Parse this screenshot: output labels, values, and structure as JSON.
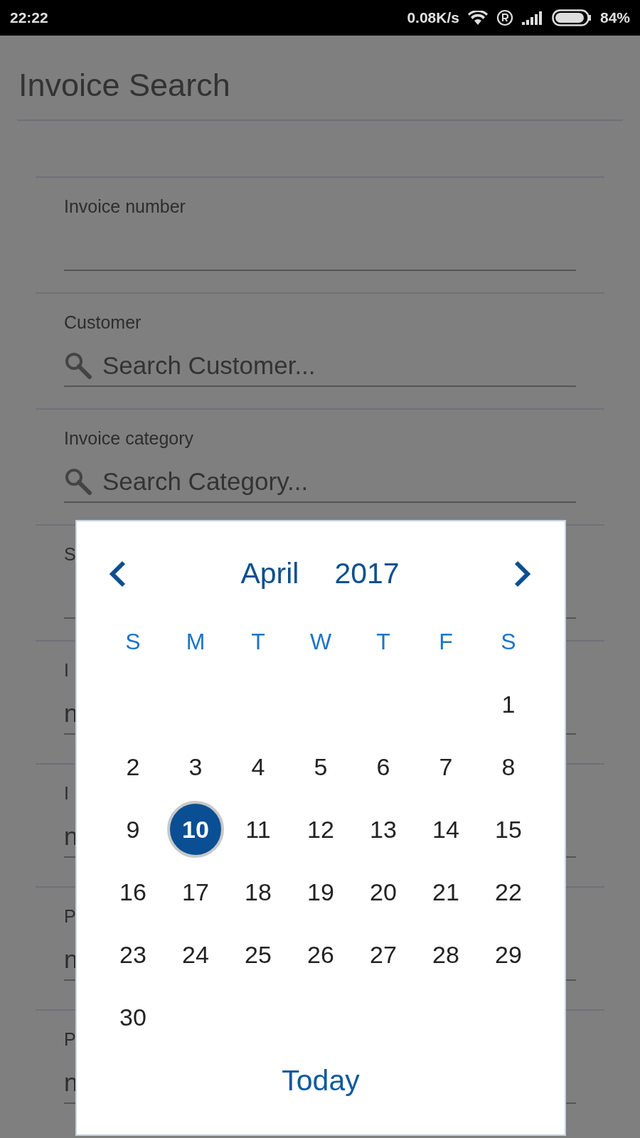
{
  "status_bar": {
    "time": "22:22",
    "net_speed": "0.08K/s",
    "battery": "84%"
  },
  "page": {
    "title": "Invoice Search"
  },
  "fields": [
    {
      "kind": "text",
      "label": "Invoice number"
    },
    {
      "kind": "search",
      "label": "Customer",
      "placeholder": "Search Customer..."
    },
    {
      "kind": "search",
      "label": "Invoice category",
      "placeholder": "Search Category..."
    },
    {
      "kind": "text",
      "label": "S"
    },
    {
      "kind": "text",
      "label": "I",
      "value": "n"
    },
    {
      "kind": "text",
      "label": "I",
      "value": "n"
    },
    {
      "kind": "text",
      "label": "P",
      "value": "n"
    },
    {
      "kind": "text",
      "label": "P",
      "value": "n"
    }
  ],
  "date_picker": {
    "month": "April",
    "year": "2017",
    "weekdays": [
      "S",
      "M",
      "T",
      "W",
      "T",
      "F",
      "S"
    ],
    "weeks": [
      {
        "kind": "first_week",
        "days": [
          {
            "day": "1",
            "selected": false
          }
        ]
      },
      {
        "kind": "week",
        "days": [
          {
            "day": "2",
            "selected": false
          },
          {
            "day": "3",
            "selected": false
          },
          {
            "day": "4",
            "selected": false
          },
          {
            "day": "5",
            "selected": false
          },
          {
            "day": "6",
            "selected": false
          },
          {
            "day": "7",
            "selected": false
          },
          {
            "day": "8",
            "selected": false
          }
        ]
      },
      {
        "kind": "week",
        "days": [
          {
            "day": "9",
            "selected": false
          },
          {
            "day": "10",
            "selected": true
          },
          {
            "day": "11",
            "selected": false
          },
          {
            "day": "12",
            "selected": false
          },
          {
            "day": "13",
            "selected": false
          },
          {
            "day": "14",
            "selected": false
          },
          {
            "day": "15",
            "selected": false
          }
        ]
      },
      {
        "kind": "week",
        "days": [
          {
            "day": "16",
            "selected": false
          },
          {
            "day": "17",
            "selected": false
          },
          {
            "day": "18",
            "selected": false
          },
          {
            "day": "19",
            "selected": false
          },
          {
            "day": "20",
            "selected": false
          },
          {
            "day": "21",
            "selected": false
          },
          {
            "day": "22",
            "selected": false
          }
        ]
      },
      {
        "kind": "week",
        "days": [
          {
            "day": "23",
            "selected": false
          },
          {
            "day": "24",
            "selected": false
          },
          {
            "day": "25",
            "selected": false
          },
          {
            "day": "26",
            "selected": false
          },
          {
            "day": "27",
            "selected": false
          },
          {
            "day": "28",
            "selected": false
          },
          {
            "day": "29",
            "selected": false
          }
        ]
      },
      {
        "kind": "week",
        "days": [
          {
            "day": "30",
            "selected": false
          }
        ]
      }
    ],
    "today_button": "Today"
  }
}
